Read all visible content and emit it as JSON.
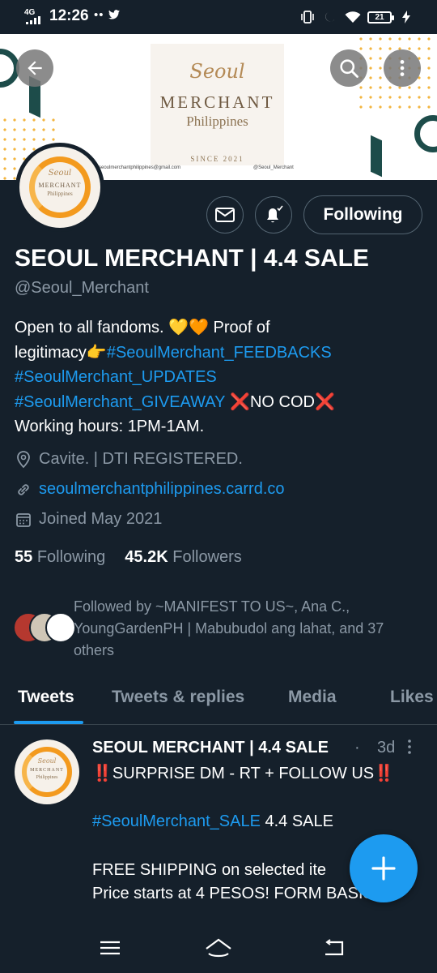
{
  "status_bar": {
    "network": "4G",
    "time": "12:26",
    "notifications": "••",
    "battery": "21"
  },
  "banner": {
    "brand_script": "Seoul",
    "brand_main": "MERCHANT",
    "brand_sub": "Philippines",
    "since": "SINCE 2021",
    "email": "seoulmerchantphilippines@gmail.com",
    "handle": "@Seoul_Merchant"
  },
  "header": {
    "back_icon": "arrow-left-icon",
    "search_icon": "search-icon",
    "more_icon": "more-vertical-icon"
  },
  "profile": {
    "avatar_script": "Seoul",
    "avatar_main": "MERCHANT",
    "avatar_sub": "Philippines",
    "name": "SEOUL MERCHANT | 4.4 SALE",
    "handle": "@Seoul_Merchant",
    "follow_button": "Following",
    "bio": {
      "line1_text": "Open to all fandoms. ",
      "line1_emoji": "💛🧡",
      "line1_text2": " Proof of",
      "line2_text": "legitimacy",
      "line2_emoji": "👉",
      "line2_link": "#SeoulMerchant_FEEDBACKS",
      "line3_link": "#SeoulMerchant_UPDATES",
      "line4_link": "#SeoulMerchant_GIVEAWAY",
      "line4_mark1": " ❌",
      "line4_text": "NO COD",
      "line4_mark2": "❌",
      "line5_text": "Working hours: 1PM-1AM."
    },
    "location": "Cavite. | DTI REGISTERED.",
    "website": "seoulmerchantphilippines.carrd.co",
    "joined": "Joined May 2021",
    "following_count": "55",
    "following_label": "Following",
    "followers_count": "45.2K",
    "followers_label": "Followers",
    "followed_by": "Followed by ~MANIFEST TO US~, Ana C., YoungGardenPH | Mabubudol ang lahat, and 37 others"
  },
  "tabs": [
    {
      "label": "Tweets",
      "active": true
    },
    {
      "label": "Tweets & replies",
      "active": false
    },
    {
      "label": "Media",
      "active": false
    },
    {
      "label": "Likes",
      "active": false
    }
  ],
  "tweet": {
    "name": "SEOUL MERCHANT | 4.4 SALE",
    "dot": "·",
    "time": "3d",
    "line1_mark1": "‼️",
    "line1_text": "SURPRISE DM - RT + FOLLOW US",
    "line1_mark2": "‼️",
    "line2_link": "#SeoulMerchant_SALE",
    "line2_text": " 4.4 SALE",
    "line3_text": "FREE SHIPPING on selected ite",
    "line4_text": "Price starts at 4 PESOS! FORM BASIS"
  },
  "fab": {
    "icon": "plus-icon"
  },
  "nav": {
    "menu_icon": "menu-icon",
    "home_icon": "home-icon",
    "back_icon": "back-icon"
  },
  "colors": {
    "background": "#15202b",
    "accent": "#1d9bf0",
    "muted": "#8b98a5",
    "border": "#536471"
  }
}
